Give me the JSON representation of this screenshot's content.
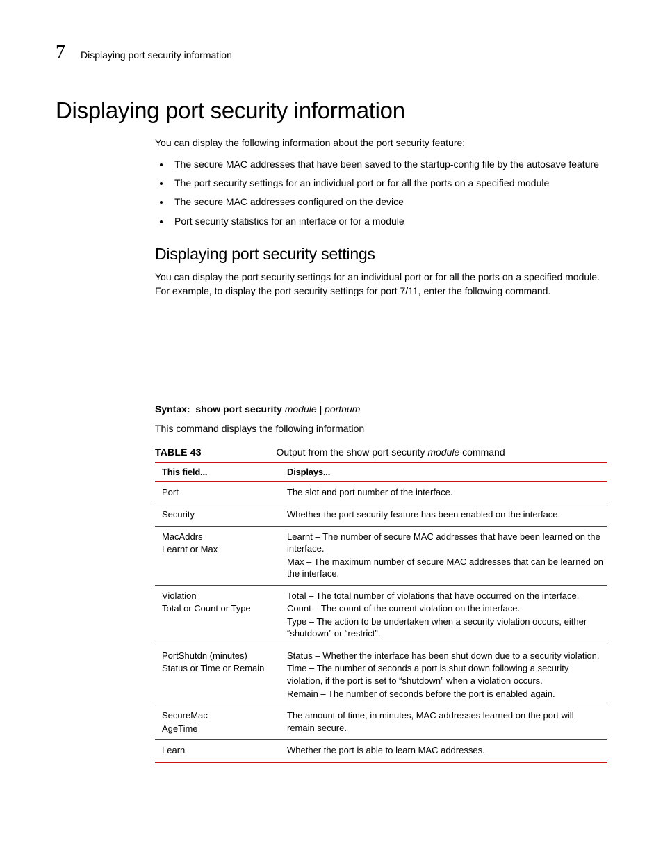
{
  "header": {
    "chapter_number": "7",
    "running_title": "Displaying port security information"
  },
  "h1": "Displaying port security information",
  "intro": "You can display the following information about the port security feature:",
  "bullets": [
    "The secure MAC addresses that have been saved to the startup-config file by the autosave feature",
    "The port security settings for an individual port or for all the ports on a specified module",
    "The secure MAC addresses configured on the device",
    "Port security statistics for an interface or for a module"
  ],
  "h2": "Displaying port security settings",
  "para2": "You can display the port security settings for an individual port or for all the ports on a specified module. For example, to display the port security settings for port 7/11, enter the following command.",
  "syntax": {
    "label": "Syntax:",
    "command": "show port security",
    "args": "module | portnum"
  },
  "para3": "This command displays the following information",
  "table_caption": {
    "label": "TABLE 43",
    "text_pre": "Output from the show port security ",
    "text_arg": "module",
    "text_post": " command"
  },
  "table": {
    "head": [
      "This field...",
      "Displays..."
    ],
    "rows": [
      {
        "f": "Port",
        "d": [
          "The slot and port number of the interface."
        ]
      },
      {
        "f": "Security",
        "d": [
          "Whether the port security feature has been enabled on the interface."
        ]
      },
      {
        "f": "MacAddrs\nLearnt or Max",
        "d": [
          "Learnt – The number of secure MAC addresses that have been learned on the interface.",
          "Max – The maximum number of secure MAC addresses that can be learned on the interface."
        ]
      },
      {
        "f": "Violation\nTotal or Count or Type",
        "d": [
          "Total – The total number of violations that have occurred on the interface.",
          "Count – The count of the current violation on the interface.",
          "Type – The action to be undertaken when a security violation occurs, either “shutdown” or “restrict”."
        ]
      },
      {
        "f": "PortShutdn (minutes)\nStatus or Time or Remain",
        "d": [
          "Status – Whether the interface has been shut down due to a security violation.",
          "Time – The number of seconds a port is shut down following a security violation, if the port is set to “shutdown” when a violation occurs.",
          "Remain – The number of seconds before the port is enabled again."
        ]
      },
      {
        "f": "SecureMac\nAgeTime",
        "d": [
          "The amount of time, in minutes, MAC addresses learned on the port will remain secure."
        ]
      },
      {
        "f": "Learn",
        "d": [
          "Whether the port is able to learn MAC addresses."
        ]
      }
    ]
  }
}
